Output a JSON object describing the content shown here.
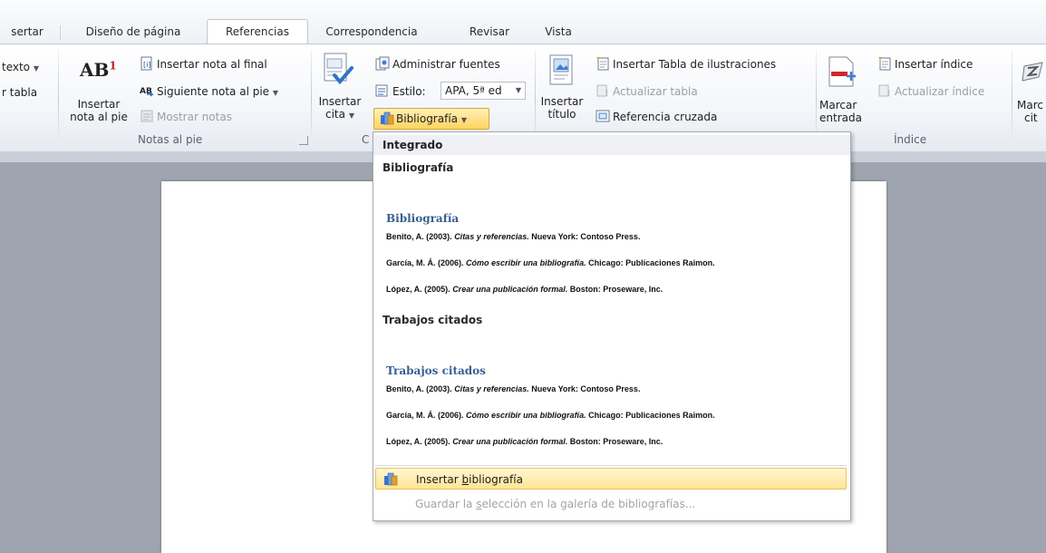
{
  "tabs": {
    "t0": "sertar",
    "t1": "Diseño de página",
    "t2": "Referencias",
    "t3": "Correspondencia",
    "t4": "Revisar",
    "t5": "Vista"
  },
  "ribbon": {
    "cut_texto": "texto",
    "cut_tabla": "r tabla",
    "notas": {
      "insertar_nota_line1": "Insertar",
      "insertar_nota_line2": "nota al pie",
      "ab_icon": "AB",
      "insertar_nota_final": "Insertar nota al final",
      "siguiente_nota": "Siguiente nota al pie",
      "mostrar_notas": "Mostrar notas",
      "group_label": "Notas al pie"
    },
    "citas": {
      "insertar_cita_line1": "Insertar",
      "insertar_cita_line2": "cita",
      "administrar_fuentes": "Administrar fuentes",
      "estilo_label": "Estilo:",
      "estilo_value": "APA, 5ª ed",
      "bibliografia": "Bibliografía",
      "group_label_cut": "C"
    },
    "titulos": {
      "insertar_titulo_line1": "Insertar",
      "insertar_titulo_line2": "título",
      "insertar_tabla_ilustraciones": "Insertar Tabla de ilustraciones",
      "actualizar_tabla": "Actualizar tabla",
      "referencia_cruzada": "Referencia cruzada"
    },
    "indice": {
      "marcar_entrada_line1": "Marcar",
      "marcar_entrada_line2": "entrada",
      "insertar_indice": "Insertar índice",
      "actualizar_indice": "Actualizar índice",
      "group_label": "Índice"
    },
    "cut_marcar_cita_line1": "Marc",
    "cut_marcar_cita_line2": "cit"
  },
  "menu": {
    "header": "Integrado",
    "opt1_name": "Bibliografía",
    "opt1_title": "Bibliografía",
    "opt2_name": "Trabajos citados",
    "opt2_title": "Trabajos citados",
    "entries": [
      {
        "author": "Benito, A. (2003). ",
        "work": "Citas y referencias.",
        "rest": " Nueva York: Contoso Press."
      },
      {
        "author": "García, M. Á. (2006). ",
        "work": "Cómo escribir una bibliografía.",
        "rest": " Chicago: Publicaciones Raimon."
      },
      {
        "author": "López, A. (2005). ",
        "work": "Crear una publicación formal.",
        "rest": " Boston: Proseware, Inc."
      }
    ],
    "insertar_bib_pre": "Insertar ",
    "insertar_bib_key": "b",
    "insertar_bib_post": "ibliografía",
    "guardar_pre": "Guardar la ",
    "guardar_key": "s",
    "guardar_post": "elección en la galería de bibliografías..."
  }
}
